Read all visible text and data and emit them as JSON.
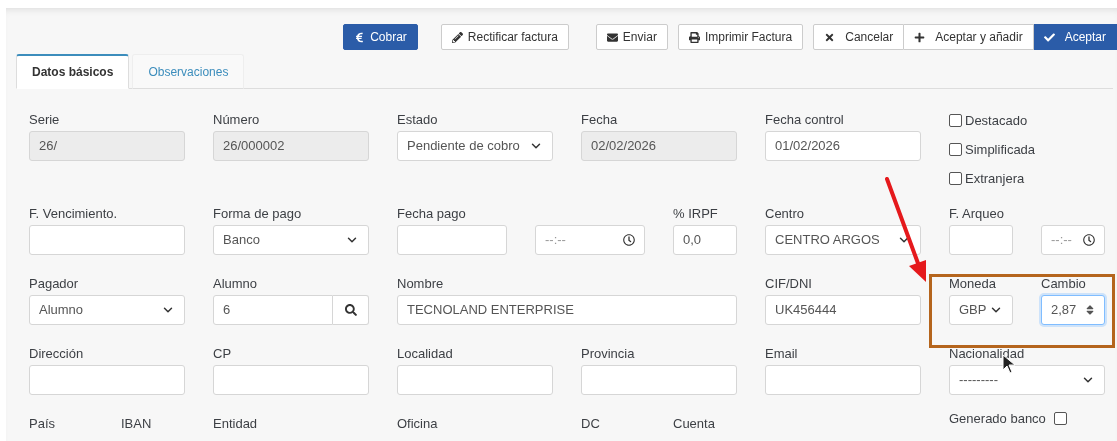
{
  "toolbar": [
    {
      "label": "Cobrar",
      "kind": "primary"
    },
    {
      "label": "Rectificar factura",
      "kind": "default"
    },
    {
      "label": "Enviar",
      "kind": "default"
    },
    {
      "label": "Imprimir Factura",
      "kind": "default"
    }
  ],
  "action_group": [
    {
      "label": "Cancelar",
      "kind": "default"
    },
    {
      "label": "Aceptar y añadir",
      "kind": "default"
    },
    {
      "label": "Aceptar",
      "kind": "primary"
    }
  ],
  "tabs": [
    {
      "label": "Datos básicos",
      "selected": true
    },
    {
      "label": "Observaciones",
      "selected": false
    }
  ],
  "rows": [
    [
      {
        "kind": "readonly",
        "label": "Serie",
        "value": "26/"
      },
      {
        "kind": "readonly",
        "label": "Número",
        "value": "26/000002"
      },
      {
        "kind": "select",
        "label": "Estado",
        "value": "Pendiente de cobro"
      },
      {
        "kind": "readonly",
        "label": "Fecha",
        "value": "02/02/2026"
      },
      {
        "kind": "text",
        "label": "Fecha control",
        "value": "01/02/2026"
      },
      {
        "kind": "checkboxes",
        "items": [
          {
            "label": "Destacado",
            "checked": false
          },
          {
            "label": "Simplificada",
            "checked": false
          },
          {
            "label": "Extranjera",
            "checked": false
          }
        ]
      }
    ],
    [
      {
        "kind": "text",
        "label": "F. Vencimiento."
      },
      {
        "kind": "select",
        "label": "Forma de pago",
        "value": "Banco"
      },
      {
        "kind": "datetime",
        "label": "Fecha pago",
        "time": "--:--"
      },
      {
        "kind": "text",
        "label": "% IRPF",
        "value": "0,0"
      },
      {
        "kind": "select",
        "label": "Centro",
        "value": "CENTRO ARGOS"
      },
      {
        "kind": "datetime",
        "label": "F. Arqueo",
        "time": "--:--"
      }
    ],
    [
      {
        "kind": "select",
        "label": "Pagador",
        "value": "Alumno"
      },
      {
        "kind": "search",
        "label": "Alumno",
        "value": "6"
      },
      {
        "kind": "text",
        "label": "Nombre",
        "value": "TECNOLAND ENTERPRISE"
      },
      {
        "kind": "text",
        "label": "CIF/DNI",
        "value": "UK456444"
      },
      {
        "kind": "select",
        "label": "Moneda",
        "value": "GBP"
      },
      {
        "kind": "number",
        "label": "Cambio",
        "value": "2,87",
        "focused": true
      }
    ],
    [
      {
        "kind": "text",
        "label": "Dirección"
      },
      {
        "kind": "text",
        "label": "CP"
      },
      {
        "kind": "text",
        "label": "Localidad"
      },
      {
        "kind": "text",
        "label": "Provincia"
      },
      {
        "kind": "text",
        "label": "Email"
      },
      {
        "kind": "select",
        "label": "Nacionalidad",
        "value": "---------"
      }
    ],
    [
      {
        "kind": "label_only",
        "label": "País"
      },
      {
        "kind": "label_only",
        "label": "IBAN"
      },
      {
        "kind": "label_only",
        "label": "Entidad"
      },
      {
        "kind": "label_only",
        "label": "Oficina"
      },
      {
        "kind": "label_only",
        "label": "DC"
      },
      {
        "kind": "label_only",
        "label": "Cuenta"
      },
      {
        "kind": "checkbox_inline",
        "label": "Generado banco",
        "checked": false
      }
    ]
  ]
}
